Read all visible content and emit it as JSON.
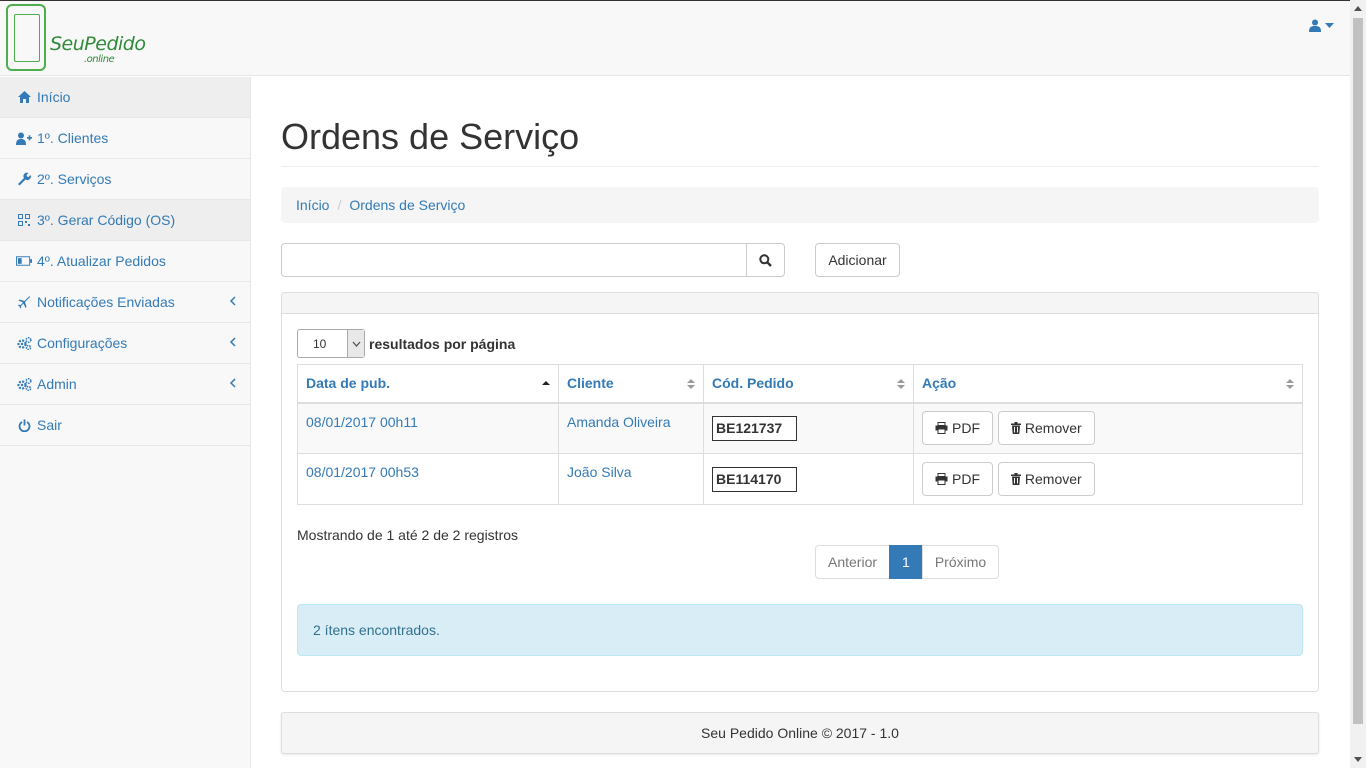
{
  "brand": {
    "logo_main": "SeuPedido",
    "logo_sub": ".online"
  },
  "icons": {
    "user_menu": "user-icon",
    "search": "search-icon",
    "pdf": "print-icon",
    "remove": "trash-icon"
  },
  "colors": {
    "link": "#337ab7",
    "brand_green": "#4cae4c",
    "pagination_active": "#337ab7",
    "alert_bg": "#d9edf7"
  },
  "sidebar": {
    "items": [
      {
        "label": "Início",
        "icon": "home-icon"
      },
      {
        "label": "1º. Clientes",
        "icon": "user-plus-icon"
      },
      {
        "label": "2º. Serviços",
        "icon": "wrench-icon"
      },
      {
        "label": "3º. Gerar Código (OS)",
        "icon": "qrcode-icon"
      },
      {
        "label": "4º. Atualizar Pedidos",
        "icon": "battery-icon"
      },
      {
        "label": "Notificações Enviadas",
        "icon": "plane-icon"
      },
      {
        "label": "Configurações",
        "icon": "cogs-icon"
      },
      {
        "label": "Admin",
        "icon": "cogs-icon"
      },
      {
        "label": "Sair",
        "icon": "power-icon"
      }
    ]
  },
  "main": {
    "title": "Ordens de Serviço",
    "breadcrumb": [
      "Início",
      "Ordens de Serviço"
    ],
    "search": {
      "value": "",
      "placeholder": ""
    },
    "add_label": "Adicionar",
    "page_length": "10",
    "page_length_label": "resultados por página",
    "table": {
      "columns": [
        "Data de pub.",
        "Cliente",
        "Cód. Pedido",
        "Ação"
      ],
      "rows": [
        {
          "date": "08/01/2017 00h11",
          "client": "Amanda Oliveira",
          "code": "BE121737"
        },
        {
          "date": "08/01/2017 00h53",
          "client": "João Silva",
          "code": "BE114170"
        }
      ],
      "pdf_label": "PDF",
      "remove_label": "Remover"
    },
    "info": "Mostrando de 1 até 2 de 2 registros",
    "pagination": {
      "prev": "Anterior",
      "current": "1",
      "next": "Próximo"
    },
    "alert": "2 ítens encontrados."
  },
  "footer": "Seu Pedido Online © 2017 - 1.0"
}
